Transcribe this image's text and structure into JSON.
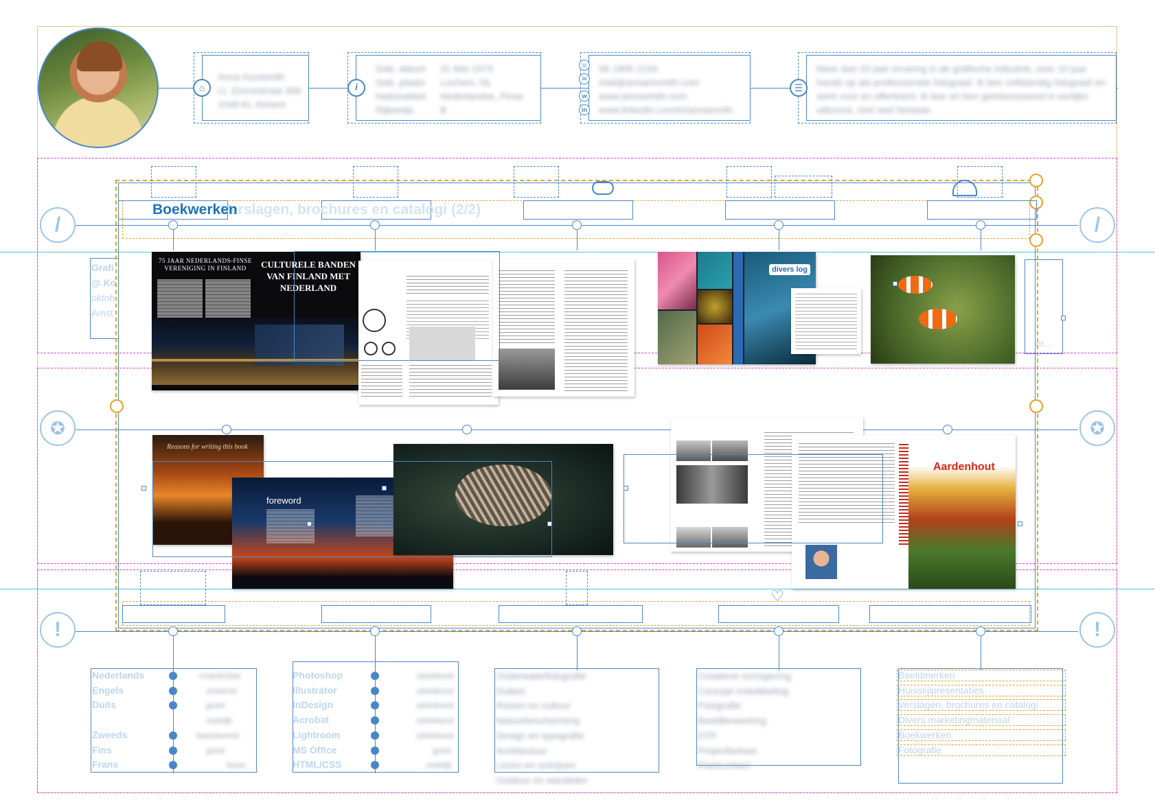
{
  "header": {
    "address_lines": [
      "Anna Koolsmith",
      "Lt. Zonnestraat 389",
      "1048 KL Almere"
    ],
    "info_labels": [
      "Geb. datum",
      "Geb. plaats",
      "Nationaliteit",
      "Rijbewijs"
    ],
    "info_values": [
      "31 Mei 1973",
      "Lochem, NL",
      "Nederlandse, Finse",
      "B"
    ],
    "contact_lines": [
      "06 1900 1234",
      "mail@annamsmith.com",
      "www.annasmith.com",
      "www.linkedin.com/in/annasmith"
    ],
    "profile_lines": [
      "Meer dan 20 jaar ervaring in de grafische industrie, zeer 10 jaar",
      "hands op als professionele fotograaf. Ik ben zelfstandig fotograaf en",
      "werk voor en offerteerd. Ik leer en ben geinteresseerd in eerlijke",
      "uitkomst, met veel fantasie."
    ]
  },
  "section": {
    "title": "Boekwerken",
    "ghost_title": "Verslagen, brochures en catalogi (2/2)"
  },
  "left_ghost_lines": [
    "Grafi",
    "@ Ko",
    "oktob",
    "Amst"
  ],
  "right_ghost_text": "er...",
  "spreads": {
    "finland_left_title": "75 JAAR NEDERLANDS-FINSE VERENIGING IN FINLAND",
    "finland_right_title": "CULTURELE BANDEN VAN FINLAND MET NEDERLAND",
    "divers_logo": "divers log",
    "foreword": "foreword",
    "reasons_title": "Reasons for writing this book",
    "aardenhout_title": "Aardenhout"
  },
  "languages": {
    "items": [
      "Nederlands",
      "Engels",
      "Duits",
      "",
      "Zweeds",
      "Fins",
      "Frans"
    ],
    "levels": [
      "moedertaal",
      "vloeiend",
      "goed",
      "redelijk",
      "basiskennis",
      "goed",
      "basis"
    ]
  },
  "software": {
    "items": [
      "Photoshop",
      "Illustrator",
      "InDesign",
      "Acrobat",
      "Lightroom",
      "MS Office",
      "HTML/CSS"
    ],
    "levels": [
      "uitstekend",
      "uitstekend",
      "uitstekend",
      "uitstekend",
      "uitstekend",
      "goed",
      "redelijk"
    ]
  },
  "interests": [
    "Onderwaterfotografie",
    "Duiken",
    "Reizen en cultuur",
    "Natuurbescherming",
    "Design en typografie",
    "Architectuur",
    "Lezen en schrijven",
    "Outdoor en wandelen"
  ],
  "skills": [
    "Creatieve vormgeving",
    "Concept ontwikkeling",
    "Fotografie",
    "Beeldbewerking",
    "DTP",
    "Projectbeheer",
    "Klantcontact"
  ],
  "portfolio_index": [
    "Beeldmerken",
    "Huisstijlpresentaties",
    "Verslagen, brochures en catalogi",
    "Divers marketingmateriaal",
    "Boekwerken",
    "Fotografie"
  ],
  "colors": {
    "frame_blue": "#4a86c8",
    "guide_magenta": "#e23ce6",
    "guide_orange": "#e8a12a",
    "guide_cyan": "#4fc3e0",
    "title_blue": "#1a74b8",
    "faded_text": "#bcd6ef"
  },
  "icons": [
    "home-icon",
    "info-icon",
    "phone-icon",
    "email-icon",
    "web-icon",
    "linkedin-icon",
    "list-icon",
    "pencil-icon",
    "award-icon",
    "exclamation-icon"
  ]
}
